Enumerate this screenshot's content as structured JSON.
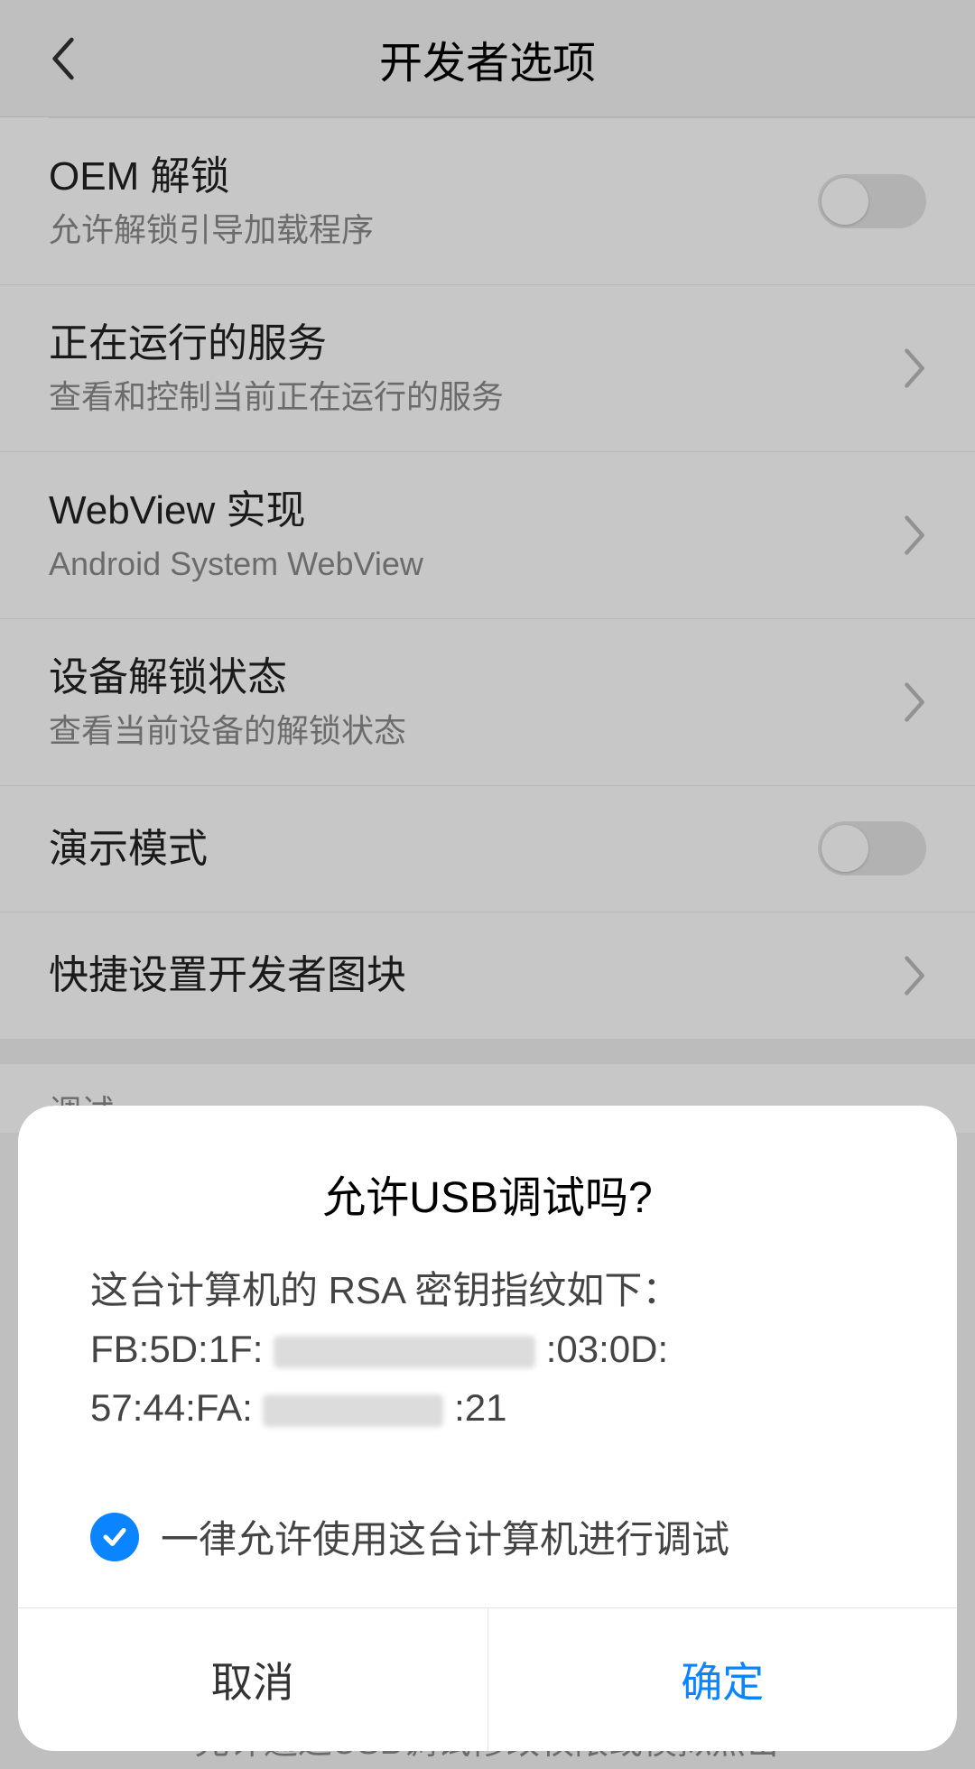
{
  "header": {
    "title": "开发者选项"
  },
  "rows": {
    "oem": {
      "title": "OEM 解锁",
      "sub": "允许解锁引导加载程序"
    },
    "services": {
      "title": "正在运行的服务",
      "sub": "查看和控制当前正在运行的服务"
    },
    "webview": {
      "title": "WebView 实现",
      "sub": "Android System WebView"
    },
    "unlock": {
      "title": "设备解锁状态",
      "sub": "查看当前设备的解锁状态"
    },
    "demo": {
      "title": "演示模式"
    },
    "tiles": {
      "title": "快捷设置开发者图块"
    }
  },
  "section_label": "调试",
  "dialog": {
    "title": "允许USB调试吗?",
    "body_intro": "这台计算机的 RSA 密钥指纹如下：",
    "fp1_a": "FB:5D:1F:",
    "fp1_b": ":03:0D:",
    "fp2_a": "57:44:FA:",
    "fp2_b": ":21",
    "always": "一律允许使用这台计算机进行调试",
    "cancel": "取消",
    "ok": "确定"
  },
  "peek": "允许通过USB调试修改权限或模拟点击"
}
